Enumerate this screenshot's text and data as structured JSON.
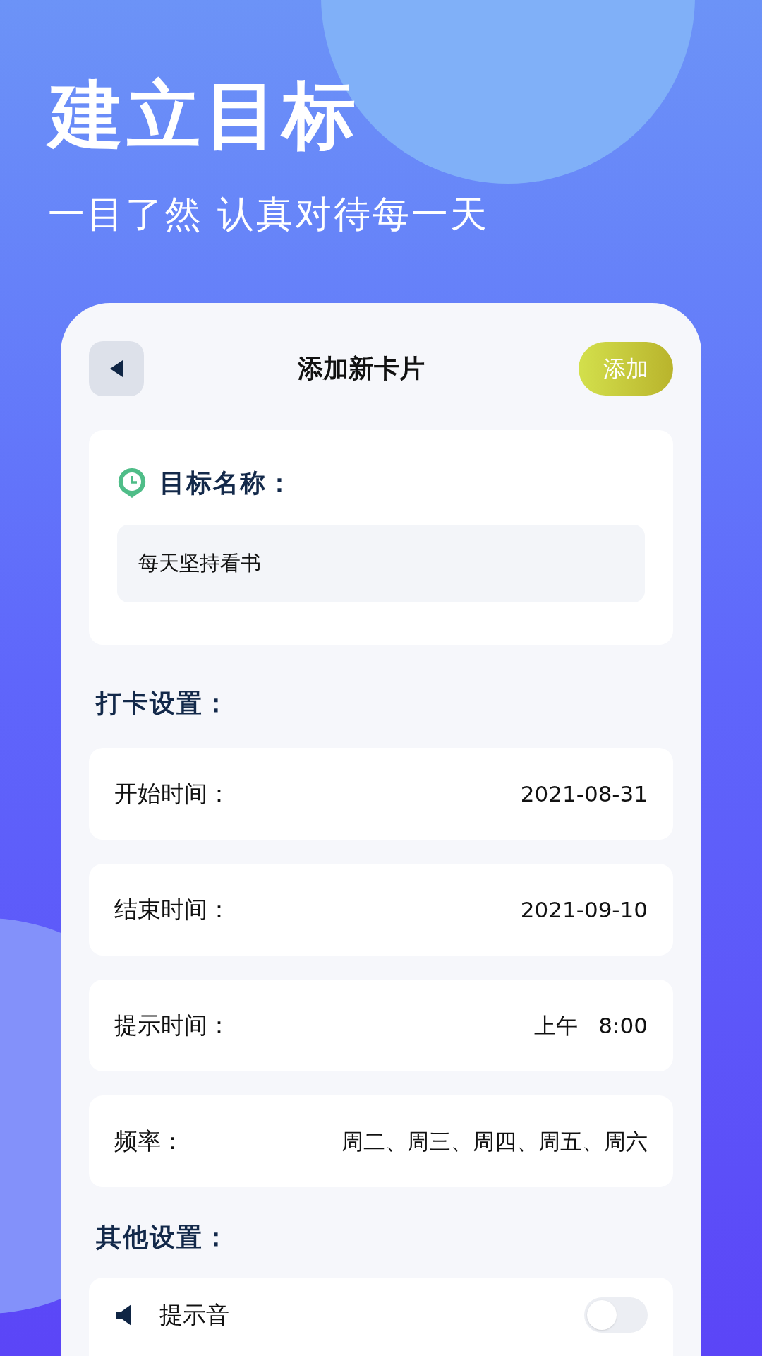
{
  "headline": "建立目标",
  "tagline": "一目了然 认真对待每一天",
  "screen": {
    "title": "添加新卡片",
    "add_button": "添加",
    "goal": {
      "label": "目标名称：",
      "value": "每天坚持看书"
    },
    "checkin_section": "打卡设置：",
    "settings": [
      {
        "label": "开始时间：",
        "value": "2021-08-31"
      },
      {
        "label": "结束时间：",
        "value": "2021-09-10"
      },
      {
        "label": "提示时间：",
        "value": "上午   8:00"
      },
      {
        "label": "频率：",
        "value": "周二、周三、周四、周五、周六"
      }
    ],
    "other_section": "其他设置：",
    "other": [
      {
        "label": "提示音",
        "on": false
      }
    ]
  }
}
